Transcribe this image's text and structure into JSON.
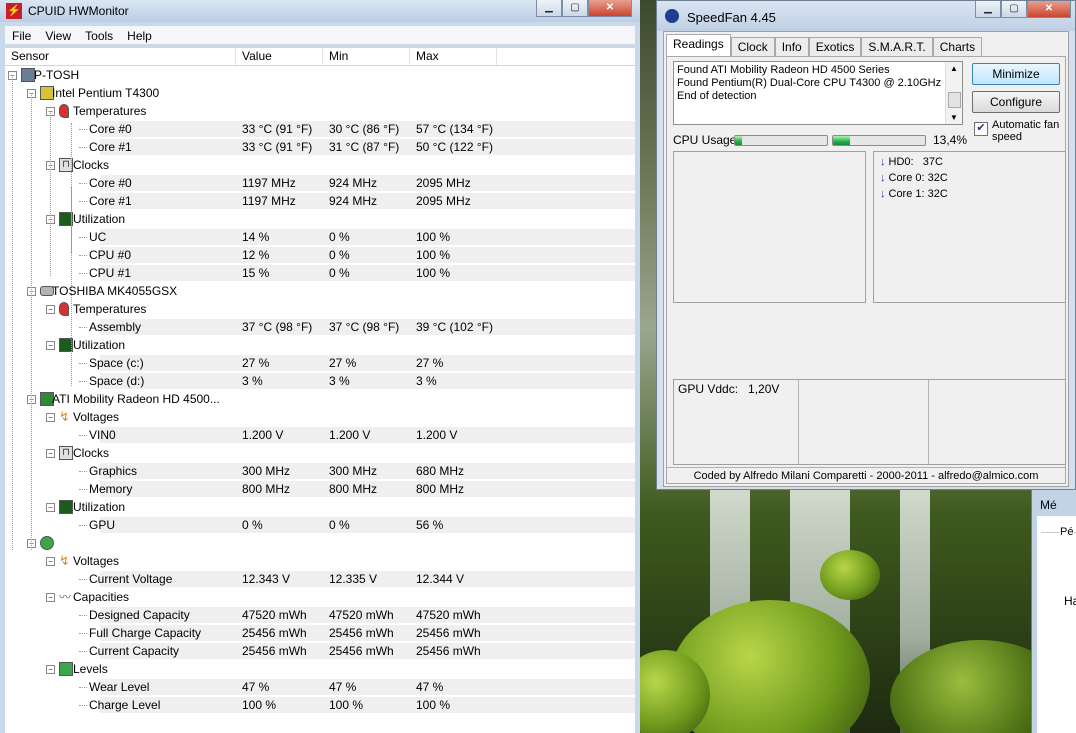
{
  "hwmonitor": {
    "title": "CPUID HWMonitor",
    "menu": [
      "File",
      "View",
      "Tools",
      "Help"
    ],
    "columns": [
      "Sensor",
      "Value",
      "Min",
      "Max"
    ],
    "rows": [
      {
        "level": 0,
        "icon": "computer-icon",
        "label": "P-TOSH",
        "value": "",
        "min": "",
        "max": ""
      },
      {
        "level": 1,
        "icon": "cpu-chip-icon",
        "label": "Intel Pentium T4300",
        "value": "",
        "min": "",
        "max": ""
      },
      {
        "level": 2,
        "icon": "thermometer-icon",
        "label": "Temperatures",
        "value": "",
        "min": "",
        "max": ""
      },
      {
        "level": 3,
        "label": "Core #0",
        "value": "33 °C  (91 °F)",
        "min": "30 °C  (86 °F)",
        "max": "57 °C  (134 °F)"
      },
      {
        "level": 3,
        "label": "Core #1",
        "value": "33 °C  (91 °F)",
        "min": "31 °C  (87 °F)",
        "max": "50 °C  (122 °F)"
      },
      {
        "level": 2,
        "icon": "clock-wave-icon",
        "label": "Clocks",
        "value": "",
        "min": "",
        "max": ""
      },
      {
        "level": 3,
        "label": "Core #0",
        "value": "1197 MHz",
        "min": "924 MHz",
        "max": "2095 MHz"
      },
      {
        "level": 3,
        "label": "Core #1",
        "value": "1197 MHz",
        "min": "924 MHz",
        "max": "2095 MHz"
      },
      {
        "level": 2,
        "icon": "utilization-graph-icon",
        "label": "Utilization",
        "value": "",
        "min": "",
        "max": ""
      },
      {
        "level": 3,
        "label": "UC",
        "value": "14 %",
        "min": "0 %",
        "max": "100 %"
      },
      {
        "level": 3,
        "label": "CPU #0",
        "value": "12 %",
        "min": "0 %",
        "max": "100 %"
      },
      {
        "level": 3,
        "label": "CPU #1",
        "value": "15 %",
        "min": "0 %",
        "max": "100 %"
      },
      {
        "level": 1,
        "icon": "hard-disk-icon",
        "label": "TOSHIBA MK4055GSX",
        "value": "",
        "min": "",
        "max": ""
      },
      {
        "level": 2,
        "icon": "thermometer-icon",
        "label": "Temperatures",
        "value": "",
        "min": "",
        "max": ""
      },
      {
        "level": 3,
        "label": "Assembly",
        "value": "37 °C  (98 °F)",
        "min": "37 °C  (98 °F)",
        "max": "39 °C  (102 °F)"
      },
      {
        "level": 2,
        "icon": "utilization-graph-icon",
        "label": "Utilization",
        "value": "",
        "min": "",
        "max": ""
      },
      {
        "level": 3,
        "label": "Space (c:)",
        "value": "27 %",
        "min": "27 %",
        "max": "27 %"
      },
      {
        "level": 3,
        "label": "Space (d:)",
        "value": "3 %",
        "min": "3 %",
        "max": "3 %"
      },
      {
        "level": 1,
        "icon": "graphics-card-icon",
        "label": "ATI Mobility Radeon HD 4500...",
        "value": "",
        "min": "",
        "max": ""
      },
      {
        "level": 2,
        "icon": "voltage-icon",
        "label": "Voltages",
        "value": "",
        "min": "",
        "max": ""
      },
      {
        "level": 3,
        "label": "VIN0",
        "value": "1.200 V",
        "min": "1.200 V",
        "max": "1.200 V"
      },
      {
        "level": 2,
        "icon": "clock-wave-icon",
        "label": "Clocks",
        "value": "",
        "min": "",
        "max": ""
      },
      {
        "level": 3,
        "label": "Graphics",
        "value": "300 MHz",
        "min": "300 MHz",
        "max": "680 MHz"
      },
      {
        "level": 3,
        "label": "Memory",
        "value": "800 MHz",
        "min": "800 MHz",
        "max": "800 MHz"
      },
      {
        "level": 2,
        "icon": "utilization-graph-icon",
        "label": "Utilization",
        "value": "",
        "min": "",
        "max": ""
      },
      {
        "level": 3,
        "label": "GPU",
        "value": "0 %",
        "min": "0 %",
        "max": "56 %"
      },
      {
        "level": 1,
        "icon": "battery-icon",
        "label": "",
        "value": "",
        "min": "",
        "max": ""
      },
      {
        "level": 2,
        "icon": "voltage-icon",
        "label": "Voltages",
        "value": "",
        "min": "",
        "max": ""
      },
      {
        "level": 3,
        "label": "Current Voltage",
        "value": "12.343 V",
        "min": "12.335 V",
        "max": "12.344 V"
      },
      {
        "level": 2,
        "icon": "capacity-wave-icon",
        "label": "Capacities",
        "value": "",
        "min": "",
        "max": ""
      },
      {
        "level": 3,
        "label": "Designed Capacity",
        "value": "47520 mWh",
        "min": "47520 mWh",
        "max": "47520 mWh"
      },
      {
        "level": 3,
        "label": "Full Charge Capacity",
        "value": "25456 mWh",
        "min": "25456 mWh",
        "max": "25456 mWh"
      },
      {
        "level": 3,
        "label": "Current Capacity",
        "value": "25456 mWh",
        "min": "25456 mWh",
        "max": "25456 mWh"
      },
      {
        "level": 2,
        "icon": "levels-bar-icon",
        "label": "Levels",
        "value": "",
        "min": "",
        "max": ""
      },
      {
        "level": 3,
        "label": "Wear Level",
        "value": "47 %",
        "min": "47 %",
        "max": "47 %"
      },
      {
        "level": 3,
        "label": "Charge Level",
        "value": "100 %",
        "min": "100 %",
        "max": "100 %"
      }
    ]
  },
  "speedfan": {
    "title": "SpeedFan 4.45",
    "tabs": [
      "Readings",
      "Clock",
      "Info",
      "Exotics",
      "S.M.A.R.T.",
      "Charts"
    ],
    "active_tab": "Readings",
    "log_lines": [
      "Found ATI Mobility Radeon HD 4500 Series",
      "Found Pentium(R) Dual-Core CPU T4300 @ 2.10GHz",
      "End of detection"
    ],
    "minimize_label": "Minimize",
    "configure_label": "Configure",
    "auto_fan_label": "Automatic fan speed",
    "auto_fan_checked": true,
    "cpu_usage_label": "CPU Usage",
    "cpu_usage_text": "13,4%",
    "cpu_bar_fraction": [
      0.08,
      0.18
    ],
    "temps": [
      {
        "label": "HD0:",
        "value": "37C"
      },
      {
        "label": "Core 0:",
        "value": "32C"
      },
      {
        "label": "Core 1:",
        "value": "32C"
      }
    ],
    "voltage_label": "GPU Vddc:",
    "voltage_value": "1,20V",
    "status": "Coded by Alfredo Milani Comparetti - 2000-2011 - alfredo@almico.com"
  },
  "third_window": {
    "title_fragment": "Mé",
    "group_fragment": "Pé",
    "text_fragment": "Ha"
  }
}
